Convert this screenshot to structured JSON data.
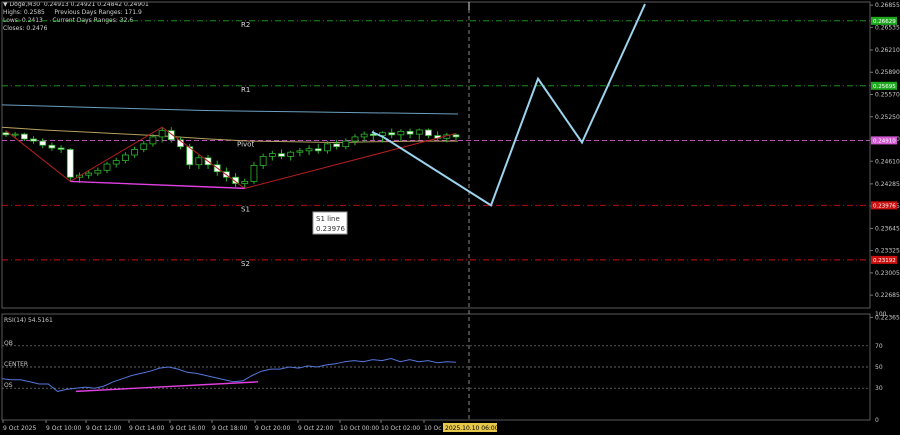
{
  "header": {
    "line1": "▼ Doge,M30  0.24913 0.24921 0.24842 0.24901",
    "line2": "Highs: 0.2585     Previous Days Ranges: 171.9",
    "line3": "Lows: 0.2413     Current Days Ranges: 32.6",
    "line4": "Closes: 0.2476"
  },
  "chart_data": {
    "type": "line",
    "symbol": "Doge,M30",
    "ylim": [
      0.225,
      0.269
    ],
    "price_ticks": [
      "0.26855",
      "0.26535",
      "0.26210",
      "0.25890",
      "0.25570",
      "0.25250",
      "0.24930",
      "0.24610",
      "0.24285",
      "0.23965",
      "0.23645",
      "0.23325",
      "0.23005",
      "0.22685",
      "0.22365"
    ],
    "levels": [
      {
        "label": "R2",
        "value": 0.26629,
        "color": "#1ea81e",
        "tag": "0.26629"
      },
      {
        "label": "R1",
        "value": 0.25695,
        "color": "#1ea81e",
        "tag": "0.25695"
      },
      {
        "label": "Pivot",
        "value": 0.2491,
        "color": "#d25ad2",
        "tag": "0.24910"
      },
      {
        "label": "S1",
        "value": 0.23976,
        "color": "#cc1010",
        "tag": "0.23976"
      },
      {
        "label": "S2",
        "value": 0.23192,
        "color": "#cc1010",
        "tag": "0.23192"
      }
    ],
    "s1_callout": {
      "title": "S1 line",
      "value": "0.23976"
    },
    "candles": [
      [
        0.2502,
        0.2505,
        0.2496,
        0.2499
      ],
      [
        0.2499,
        0.2503,
        0.2494,
        0.25
      ],
      [
        0.25,
        0.2502,
        0.249,
        0.2493
      ],
      [
        0.2493,
        0.2497,
        0.2486,
        0.249
      ],
      [
        0.249,
        0.2494,
        0.248,
        0.2484
      ],
      [
        0.2484,
        0.2488,
        0.2476,
        0.248
      ],
      [
        0.248,
        0.2484,
        0.2473,
        0.2478
      ],
      [
        0.2478,
        0.248,
        0.2432,
        0.2438
      ],
      [
        0.2438,
        0.2445,
        0.243,
        0.2441
      ],
      [
        0.2441,
        0.2448,
        0.2436,
        0.2444
      ],
      [
        0.2444,
        0.2452,
        0.244,
        0.2448
      ],
      [
        0.2448,
        0.246,
        0.2444,
        0.2457
      ],
      [
        0.2457,
        0.2466,
        0.2452,
        0.2462
      ],
      [
        0.2462,
        0.2474,
        0.2458,
        0.247
      ],
      [
        0.247,
        0.2482,
        0.2466,
        0.2478
      ],
      [
        0.2478,
        0.249,
        0.2474,
        0.2486
      ],
      [
        0.2486,
        0.25,
        0.2482,
        0.2496
      ],
      [
        0.2496,
        0.251,
        0.2488,
        0.2505
      ],
      [
        0.2505,
        0.251,
        0.2488,
        0.2492
      ],
      [
        0.2492,
        0.2496,
        0.2478,
        0.2482
      ],
      [
        0.2482,
        0.2486,
        0.245,
        0.2456
      ],
      [
        0.2456,
        0.247,
        0.245,
        0.2466
      ],
      [
        0.2466,
        0.247,
        0.245,
        0.2456
      ],
      [
        0.2456,
        0.2462,
        0.244,
        0.2446
      ],
      [
        0.2446,
        0.2452,
        0.2432,
        0.2438
      ],
      [
        0.2438,
        0.2444,
        0.2424,
        0.2429
      ],
      [
        0.2429,
        0.2436,
        0.2422,
        0.2432
      ],
      [
        0.2432,
        0.246,
        0.2428,
        0.2455
      ],
      [
        0.2455,
        0.2472,
        0.245,
        0.2468
      ],
      [
        0.2468,
        0.2476,
        0.2462,
        0.2472
      ],
      [
        0.2472,
        0.2478,
        0.2464,
        0.2468
      ],
      [
        0.2468,
        0.2476,
        0.2462,
        0.2474
      ],
      [
        0.2474,
        0.248,
        0.2468,
        0.2476
      ],
      [
        0.2476,
        0.2484,
        0.247,
        0.2479
      ],
      [
        0.2479,
        0.2486,
        0.2472,
        0.2476
      ],
      [
        0.2476,
        0.249,
        0.2472,
        0.2486
      ],
      [
        0.2486,
        0.2492,
        0.2478,
        0.2482
      ],
      [
        0.2482,
        0.2494,
        0.2478,
        0.249
      ],
      [
        0.249,
        0.25,
        0.2484,
        0.2496
      ],
      [
        0.2496,
        0.2504,
        0.2488,
        0.25
      ],
      [
        0.25,
        0.2506,
        0.249,
        0.2498
      ],
      [
        0.2498,
        0.2504,
        0.2488,
        0.2502
      ],
      [
        0.2502,
        0.2508,
        0.2494,
        0.2499
      ],
      [
        0.2499,
        0.2507,
        0.249,
        0.2504
      ],
      [
        0.2504,
        0.2508,
        0.2494,
        0.25
      ],
      [
        0.25,
        0.2508,
        0.2492,
        0.2506
      ],
      [
        0.2506,
        0.2508,
        0.2494,
        0.2498
      ],
      [
        0.2498,
        0.2504,
        0.249,
        0.2494
      ],
      [
        0.2494,
        0.2502,
        0.2488,
        0.2499
      ],
      [
        0.2499,
        0.2501,
        0.2491,
        0.2496
      ]
    ],
    "ma_slow": [
      0.2542,
      0.254,
      0.2538,
      0.2536,
      0.2534,
      0.2533,
      0.2532,
      0.2531,
      0.253,
      0.2529
    ],
    "ma_fast": [
      0.251,
      0.2506,
      0.2503,
      0.25,
      0.2497,
      0.2493,
      0.249,
      0.2489,
      0.2488,
      0.2489,
      0.249,
      0.249
    ],
    "forecast": [
      [
        0.2503,
        0.2496
      ],
      [
        0.23976,
        0.25797,
        0.2488,
        0.2687
      ]
    ],
    "rsi": {
      "label": "RSI(14) 54.5161",
      "levels": [
        {
          "label": "OB",
          "value": 70
        },
        {
          "label": "CENTER",
          "value": 50
        },
        {
          "label": "OS",
          "value": 30
        }
      ],
      "ticks": [
        "100",
        "70",
        "50",
        "30",
        "0"
      ],
      "values": [
        39,
        38,
        38,
        36,
        34,
        34,
        27,
        29,
        30,
        31,
        30,
        32,
        36,
        39,
        42,
        44,
        46,
        49,
        50,
        48,
        45,
        44,
        42,
        40,
        38,
        36,
        37,
        42,
        46,
        48,
        48,
        50,
        49,
        51,
        50,
        52,
        53,
        55,
        56,
        55,
        57,
        56,
        58,
        55,
        57,
        55,
        56,
        54,
        55,
        54.5
      ]
    },
    "time_labels": [
      "9 Oct 2025",
      "9 Oct 10:00",
      "9 Oct 12:00",
      "9 Oct 14:00",
      "9 Oct 16:00",
      "9 Oct 18:00",
      "9 Oct 20:00",
      "9 Oct 22:00",
      "10 Oct 00:00",
      "10 Oct 02:00",
      "10 Oc"
    ],
    "time_cursor": "2025.10.10 06:00"
  }
}
